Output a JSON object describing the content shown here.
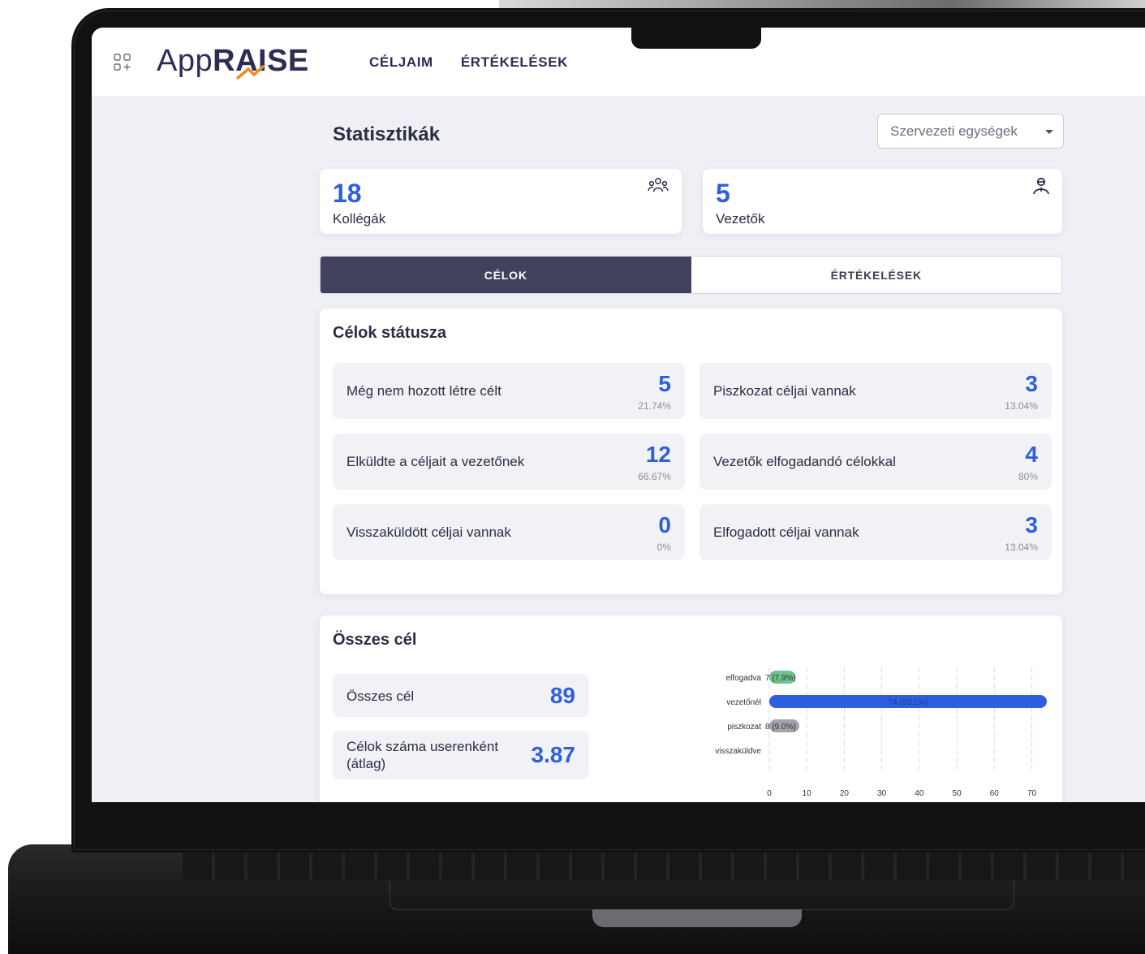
{
  "app": {
    "logo_part1": "App",
    "logo_part2": "RAISE",
    "nav": [
      "CÉLJAIM",
      "ÉRTÉKELÉSEK"
    ]
  },
  "page": {
    "title": "Statisztikák",
    "org_select_placeholder": "Szervezeti egységek"
  },
  "stats": {
    "colleagues": {
      "value": "18",
      "label": "Kollégák",
      "icon": "group-icon"
    },
    "leaders": {
      "value": "5",
      "label": "Vezetők",
      "icon": "user-tie-icon"
    }
  },
  "tabs": [
    {
      "label": "CÉLOK",
      "active": true
    },
    {
      "label": "ÉRTÉKELÉSEK",
      "active": false
    }
  ],
  "goal_status": {
    "title": "Célok státusza",
    "items": [
      {
        "label": "Még nem hozott létre célt",
        "value": "5",
        "percent": "21.74%"
      },
      {
        "label": "Piszkozat céljai vannak",
        "value": "3",
        "percent": "13.04%"
      },
      {
        "label": "Elküldte a céljait a vezetőnek",
        "value": "12",
        "percent": "66.67%"
      },
      {
        "label": "Vezetők elfogadandó célokkal",
        "value": "4",
        "percent": "80%"
      },
      {
        "label": "Visszaküldött céljai vannak",
        "value": "0",
        "percent": "0%"
      },
      {
        "label": "Elfogadott céljai vannak",
        "value": "3",
        "percent": "13.04%"
      }
    ]
  },
  "all_goals": {
    "title": "Összes cél",
    "total_label": "Összes cél",
    "total_value": "89",
    "avg_label": "Célok száma userenként (átlag)",
    "avg_value": "3.87"
  },
  "colors": {
    "accent": "#2f5fde",
    "tab_active": "#41415e",
    "bar_accepted": "#6cc48a",
    "bar_manager": "#2f5fde",
    "bar_draft": "#a3a4ad"
  },
  "chart_data": {
    "type": "bar",
    "orientation": "horizontal",
    "categories": [
      "elfogadva",
      "vezetőnél",
      "piszkozat",
      "visszaküldve"
    ],
    "values": [
      7,
      74,
      8,
      0
    ],
    "data_labels": [
      "7 (7.9%)",
      "74 (83.1%)",
      "8 (9.0%)",
      ""
    ],
    "colors": [
      "#6cc48a",
      "#2f5fde",
      "#a3a4ad",
      "#a3a4ad"
    ],
    "xlim": [
      0,
      74
    ],
    "xticks": [
      0,
      10,
      20,
      30,
      40,
      50,
      60,
      70
    ],
    "grid": true,
    "title": "",
    "xlabel": "",
    "ylabel": ""
  }
}
